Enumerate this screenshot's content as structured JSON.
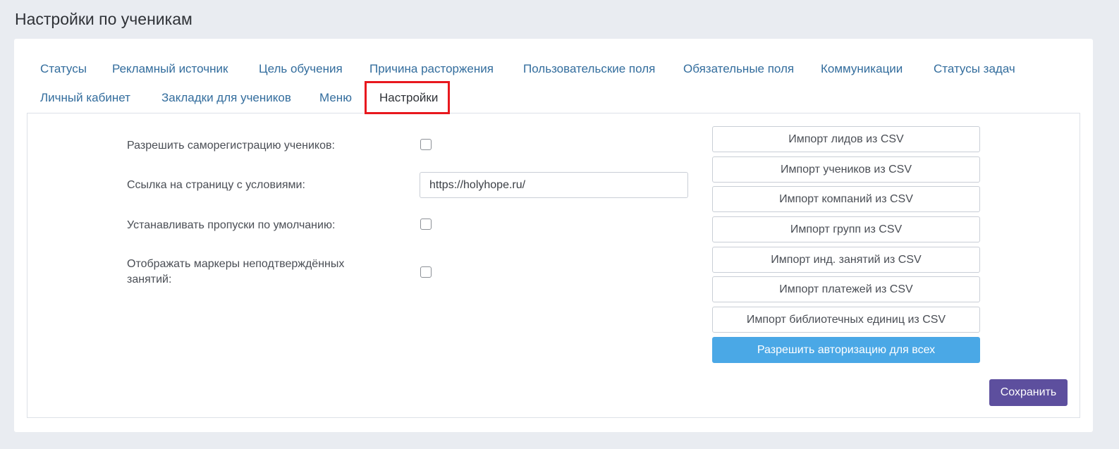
{
  "page": {
    "title": "Настройки по ученикам"
  },
  "tabs": {
    "statuses": "Статусы",
    "ad_source": "Рекламный источник",
    "learning_goal": "Цель обучения",
    "termination_reason": "Причина расторжения",
    "custom_fields": "Пользовательские поля",
    "required_fields": "Обязательные поля",
    "communications": "Коммуникации",
    "task_statuses": "Статусы задач",
    "personal_cabinet": "Личный кабинет",
    "student_bookmarks": "Закладки для учеников",
    "menu": "Меню",
    "settings": "Настройки",
    "active": "settings"
  },
  "settings": {
    "self_registration": {
      "label": "Разрешить саморегистрацию учеников:",
      "checked": false
    },
    "terms_link": {
      "label": "Ссылка на страницу с условиями:",
      "value": "https://holyhope.ru/"
    },
    "default_absences": {
      "label": "Устанавливать пропуски по умолчанию:",
      "checked": false
    },
    "unconfirmed_markers": {
      "label": "Отображать маркеры неподтверждённых занятий:",
      "checked": false
    }
  },
  "imports": {
    "leads": "Импорт лидов из CSV",
    "students": "Импорт учеников из CSV",
    "companies": "Импорт компаний из CSV",
    "groups": "Импорт групп из CSV",
    "individual_lessons": "Импорт инд. занятий из CSV",
    "payments": "Импорт платежей из CSV",
    "library_units": "Импорт библиотечных единиц из CSV"
  },
  "actions": {
    "allow_auth_all": "Разрешить авторизацию для всех",
    "save": "Сохранить"
  },
  "colors": {
    "tab_link": "#336d9d",
    "active_highlight": "#e8181e",
    "auth_button": "#4aa8e6",
    "save_button": "#5d4f9e"
  }
}
